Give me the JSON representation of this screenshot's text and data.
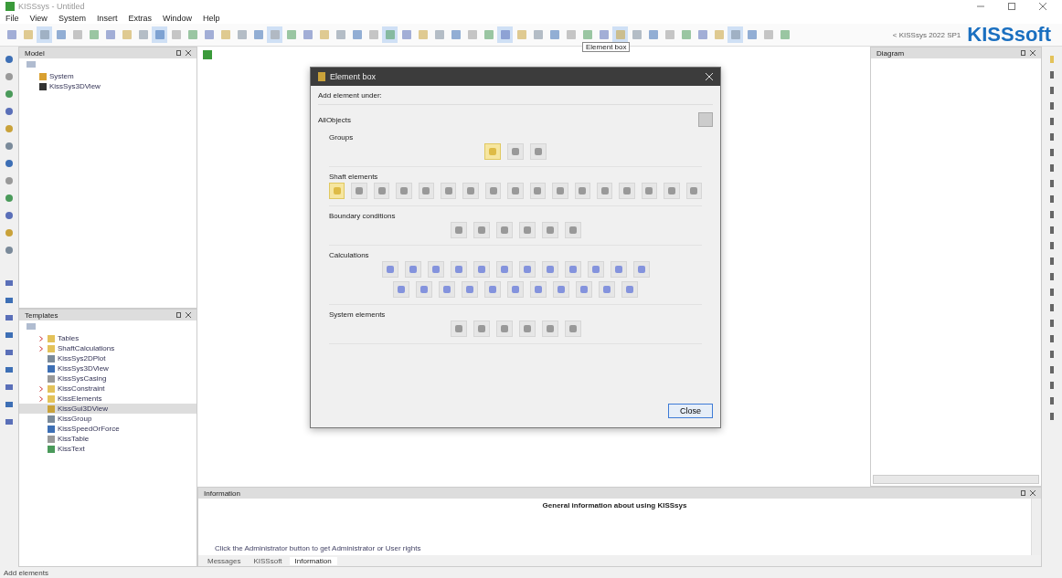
{
  "window": {
    "title": "KISSsys - Untitled"
  },
  "menu": [
    "File",
    "View",
    "System",
    "Insert",
    "Extras",
    "Window",
    "Help"
  ],
  "toolbar": {
    "tooltip": "Element box",
    "version": "< KISSsys 2022 SP1",
    "logo": "KISSsoft"
  },
  "model_panel": {
    "title": "Model",
    "items": [
      {
        "label": "System"
      },
      {
        "label": "KissSys3DView"
      }
    ]
  },
  "templates_panel": {
    "title": "Templates",
    "items": [
      {
        "label": "Tables",
        "expandable": true,
        "selected": false
      },
      {
        "label": "ShaftCalculations",
        "expandable": true,
        "selected": false
      },
      {
        "label": "KissSys2DPlot",
        "expandable": false,
        "selected": false
      },
      {
        "label": "KissSys3DView",
        "expandable": false,
        "selected": false
      },
      {
        "label": "KissSysCasing",
        "expandable": false,
        "selected": false
      },
      {
        "label": "KissConstraint",
        "expandable": true,
        "selected": false
      },
      {
        "label": "KissElements",
        "expandable": true,
        "selected": false
      },
      {
        "label": "KissGui3DView",
        "expandable": false,
        "selected": true
      },
      {
        "label": "KissGroup",
        "expandable": false,
        "selected": false
      },
      {
        "label": "KissSpeedOrForce",
        "expandable": false,
        "selected": false
      },
      {
        "label": "KissTable",
        "expandable": false,
        "selected": false
      },
      {
        "label": "KissText",
        "expandable": false,
        "selected": false
      }
    ]
  },
  "dialog": {
    "title": "Element box",
    "add_under": "Add element under:",
    "filter": "AllObjects",
    "close": "Close",
    "sections": [
      {
        "title": "Groups",
        "rows": [
          [
            {
              "selected": true
            },
            {
              "selected": false
            },
            {
              "selected": false
            }
          ]
        ]
      },
      {
        "title": "Shaft elements",
        "rows": [
          [
            {
              "selected": true
            },
            {
              "selected": false
            },
            {
              "selected": false
            },
            {
              "selected": false
            },
            {
              "selected": false
            },
            {
              "selected": false
            },
            {
              "selected": false
            },
            {
              "selected": false
            },
            {
              "selected": false
            },
            {
              "selected": false
            },
            {
              "selected": false
            },
            {
              "selected": false
            },
            {
              "selected": false
            },
            {
              "selected": false
            },
            {
              "selected": false
            },
            {
              "selected": false
            },
            {
              "selected": false
            }
          ]
        ]
      },
      {
        "title": "Boundary conditions",
        "rows": [
          [
            {
              "selected": false
            },
            {
              "selected": false
            },
            {
              "selected": false
            },
            {
              "selected": false
            },
            {
              "selected": false
            },
            {
              "selected": false
            }
          ]
        ]
      },
      {
        "title": "Calculations",
        "rows": [
          [
            {
              "selected": false
            },
            {
              "selected": false
            },
            {
              "selected": false
            },
            {
              "selected": false
            },
            {
              "selected": false
            },
            {
              "selected": false
            },
            {
              "selected": false
            },
            {
              "selected": false
            },
            {
              "selected": false
            },
            {
              "selected": false
            },
            {
              "selected": false
            },
            {
              "selected": false
            }
          ],
          [
            {
              "selected": false
            },
            {
              "selected": false
            },
            {
              "selected": false
            },
            {
              "selected": false
            },
            {
              "selected": false
            },
            {
              "selected": false
            },
            {
              "selected": false
            },
            {
              "selected": false
            },
            {
              "selected": false
            },
            {
              "selected": false
            },
            {
              "selected": false
            }
          ]
        ]
      },
      {
        "title": "System elements",
        "rows": [
          [
            {
              "selected": false
            },
            {
              "selected": false
            },
            {
              "selected": false
            },
            {
              "selected": false
            },
            {
              "selected": false
            },
            {
              "selected": false
            }
          ]
        ]
      }
    ]
  },
  "diagram_panel": {
    "title": "Diagram"
  },
  "info_panel": {
    "title": "Information",
    "heading": "General information about using KISSsys",
    "hint": "Click the Administrator button to get Administrator or User rights",
    "tabs": [
      {
        "label": "Messages",
        "selected": false
      },
      {
        "label": "KISSsoft",
        "selected": false
      },
      {
        "label": "Information",
        "selected": true
      }
    ]
  },
  "status_bar": "Add elements"
}
